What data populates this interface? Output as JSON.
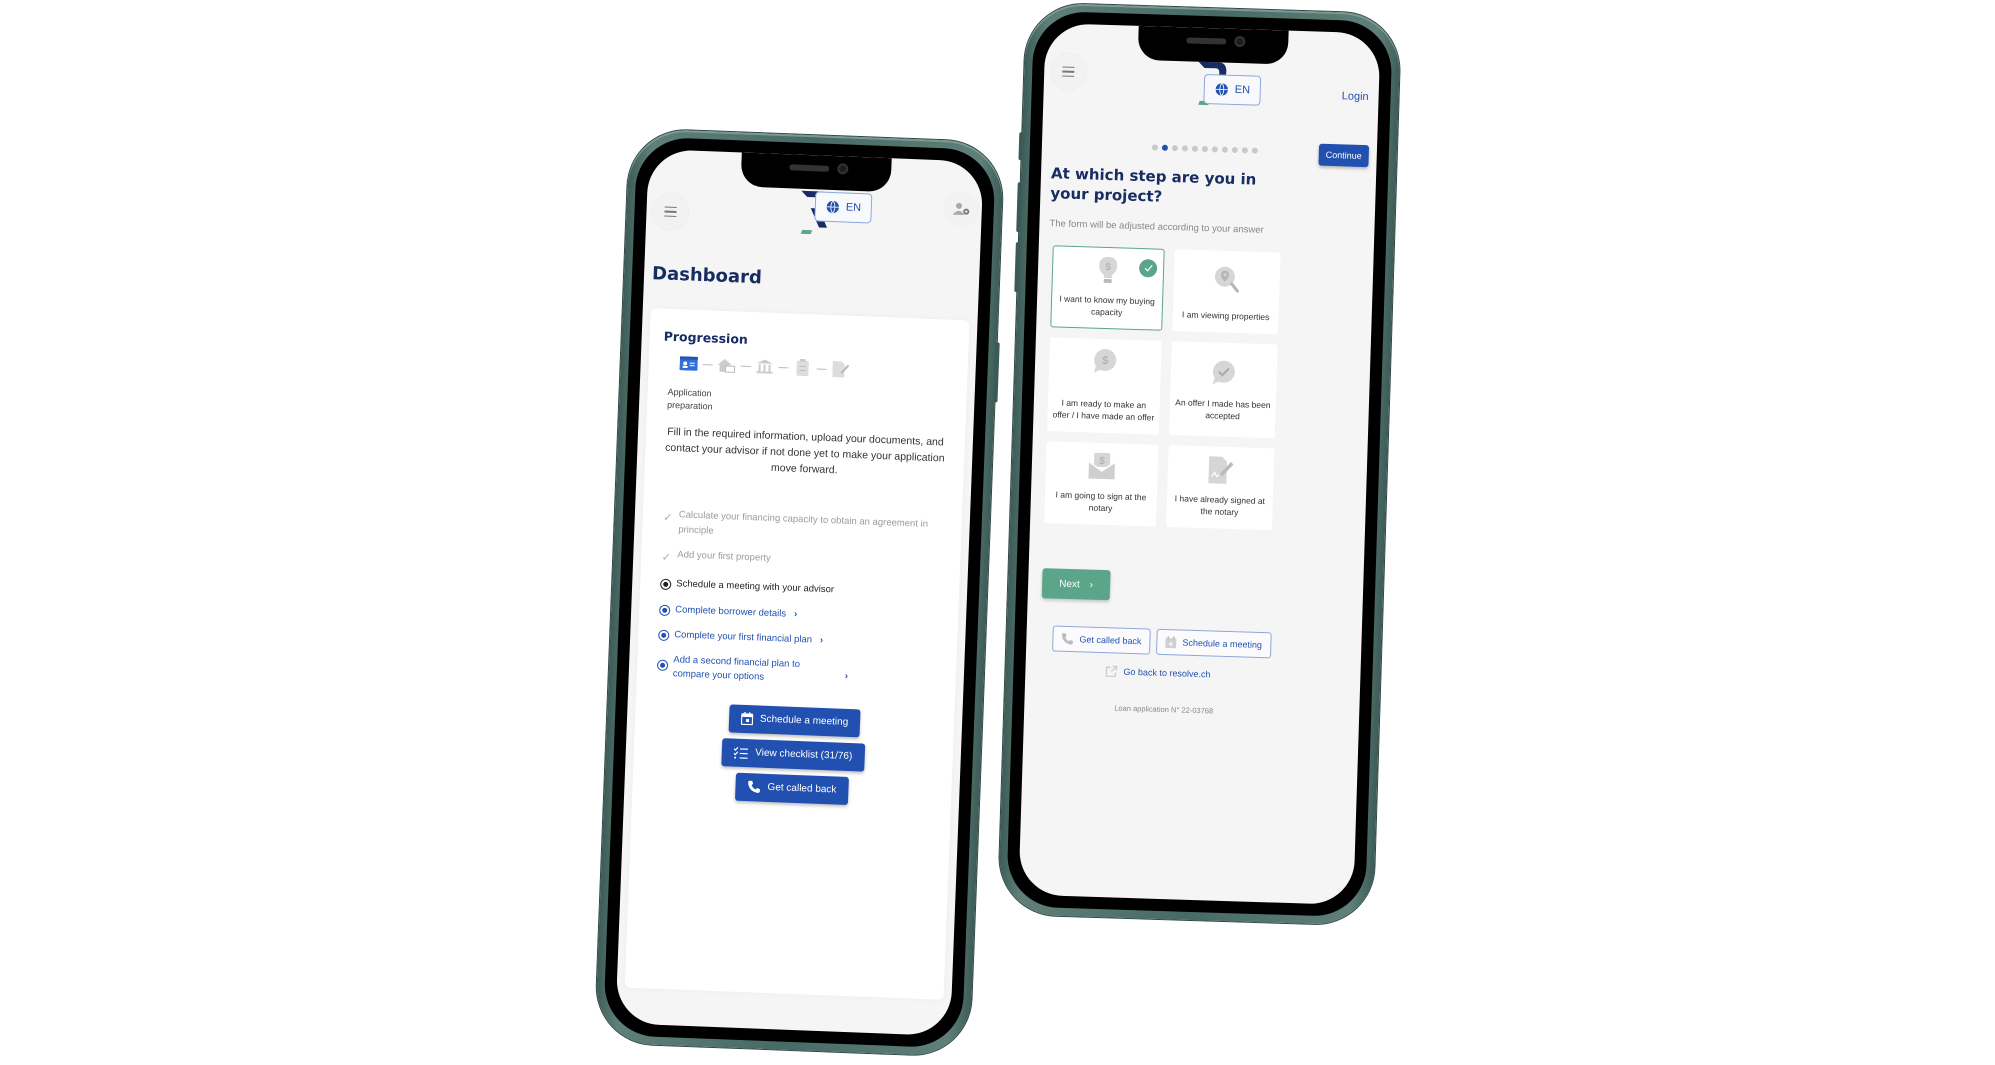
{
  "brand": {
    "logo_icon": "resolve-r-logo",
    "primary_color": "#2150b0",
    "title_color": "#162c62",
    "accent_green": "#5ba58b",
    "phone_frame_color": "#476a64"
  },
  "dashboard_phone": {
    "header": {
      "menu_icon": "hamburger-menu-icon",
      "language_label": "EN",
      "language_icon": "globe-icon",
      "user_settings_icon": "user-settings-icon"
    },
    "page_title": "Dashboard",
    "progression": {
      "title": "Progression",
      "steps": [
        {
          "icon": "id-card-icon",
          "active": true
        },
        {
          "icon": "house-laptop-icon",
          "active": false
        },
        {
          "icon": "bank-icon",
          "active": false
        },
        {
          "icon": "clipboard-checklist-icon",
          "active": false
        },
        {
          "icon": "signed-document-icon",
          "active": false
        }
      ],
      "current_step_label": "Application preparation",
      "description": "Fill in the required information, upload your documents, and contact your advisor if not done yet to make your application move forward."
    },
    "todo_items": [
      {
        "label": "Calculate your financing capacity to obtain an agreement in principle",
        "state": "done"
      },
      {
        "label": "Add your first property",
        "state": "done"
      },
      {
        "label": "Schedule a meeting with your advisor",
        "state": "current"
      },
      {
        "label": "Complete borrower details",
        "state": "link"
      },
      {
        "label": "Complete your first financial plan",
        "state": "link"
      },
      {
        "label": "Add a second financial plan to compare your options",
        "state": "link"
      }
    ],
    "actions": {
      "schedule_meeting": "Schedule a meeting",
      "view_checklist": "View checklist (31/76)",
      "get_called_back": "Get called back"
    }
  },
  "questionnaire_phone": {
    "header": {
      "menu_icon": "hamburger-menu-icon",
      "language_label": "EN",
      "language_icon": "globe-icon",
      "login_label": "Login"
    },
    "progress": {
      "total_steps": 11,
      "current_step": 2
    },
    "continue_label": "Continue",
    "question_title": "At which step are you in your project?",
    "question_subtitle": "The form will be adjusted according to your answer",
    "options": [
      {
        "label": "I want to know my buying capacity",
        "icon": "lightbulb-dollar-icon",
        "selected": true
      },
      {
        "label": "I am viewing properties",
        "icon": "location-search-icon",
        "selected": false
      },
      {
        "label": "I am ready to make an offer / I have made an offer",
        "icon": "chat-dollar-icon",
        "selected": false
      },
      {
        "label": "An offer I made has been accepted",
        "icon": "chat-check-icon",
        "selected": false
      },
      {
        "label": "I am going to sign at the notary",
        "icon": "envelope-dollar-icon",
        "selected": false
      },
      {
        "label": "I have already signed at the notary",
        "icon": "signed-document-icon",
        "selected": false
      }
    ],
    "next_label": "Next",
    "get_called_back_label": "Get called back",
    "schedule_meeting_label": "Schedule a meeting",
    "back_link_label": "Go back to resolve.ch",
    "loan_application_label": "Loan application N° 22-03768"
  }
}
